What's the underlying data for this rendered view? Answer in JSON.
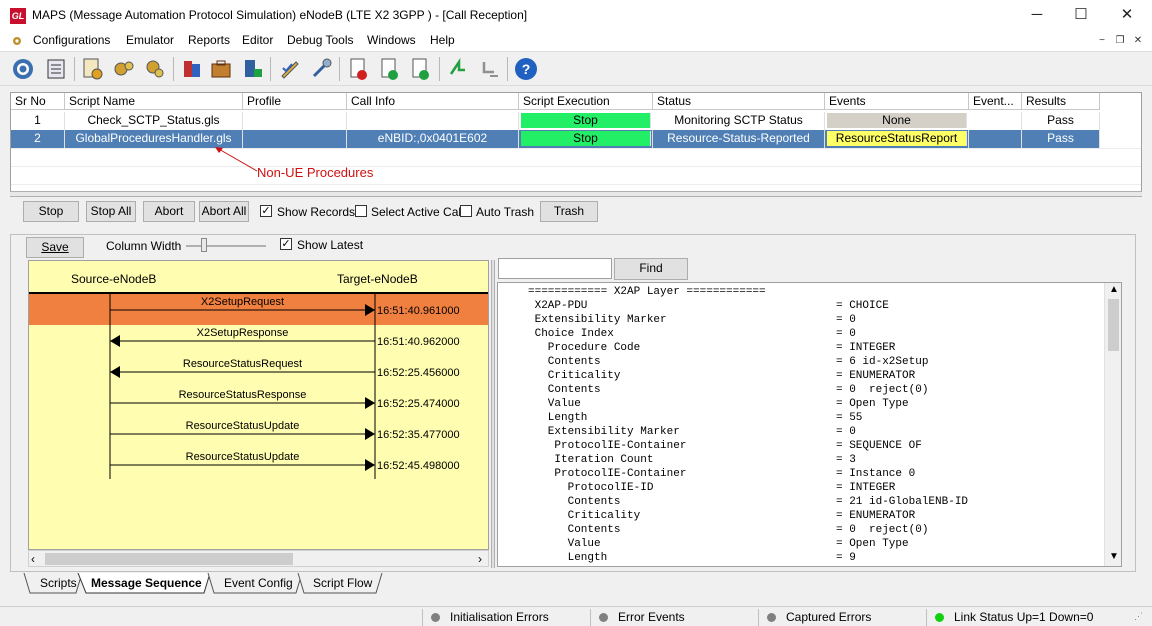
{
  "window": {
    "title": "MAPS (Message Automation Protocol Simulation) eNodeB (LTE X2 3GPP ) - [Call Reception]",
    "app_icon_text": "GL",
    "minimize": "─",
    "maximize": "☐",
    "close": "✕"
  },
  "menu": {
    "items": [
      "Configurations",
      "Emulator",
      "Reports",
      "Editor",
      "Debug Tools",
      "Windows",
      "Help"
    ]
  },
  "grid": {
    "columns": [
      "Sr No",
      "Script Name",
      "Profile",
      "Call Info",
      "Script Execution",
      "Status",
      "Events",
      "Event...",
      "Results"
    ],
    "rows": [
      {
        "sr": "1",
        "script": "Check_SCTP_Status.gls",
        "profile": "",
        "callinfo": "",
        "exec": "Stop",
        "status": "Monitoring SCTP Status",
        "events": "None",
        "event2": "",
        "results": "Pass"
      },
      {
        "sr": "2",
        "script": "GlobalProceduresHandler.gls",
        "profile": "",
        "callinfo": "eNBID:,0x0401E602",
        "exec": "Stop",
        "status": "Resource-Status-Reported",
        "events": "ResourceStatusReport",
        "event2": "",
        "results": "Pass"
      }
    ],
    "annotation": "Non-UE Procedures"
  },
  "controls": {
    "stop": "Stop",
    "stop_all": "Stop All",
    "abort": "Abort",
    "abort_all": "Abort All",
    "show_records": "Show Records",
    "select_active_call": "Select Active Call",
    "auto_trash": "Auto Trash",
    "trash": "Trash",
    "save": "Save",
    "column_width": "Column Width",
    "show_latest": "Show Latest",
    "find": "Find"
  },
  "sequence": {
    "source": "Source-eNodeB",
    "target": "Target-eNodeB",
    "messages": [
      {
        "label": "X2SetupRequest",
        "time": "16:51:40.961000",
        "dir": "right",
        "selected": true
      },
      {
        "label": "X2SetupResponse",
        "time": "16:51:40.962000",
        "dir": "left",
        "selected": false
      },
      {
        "label": "ResourceStatusRequest",
        "time": "16:52:25.456000",
        "dir": "left",
        "selected": false
      },
      {
        "label": "ResourceStatusResponse",
        "time": "16:52:25.474000",
        "dir": "right",
        "selected": false
      },
      {
        "label": "ResourceStatusUpdate",
        "time": "16:52:35.477000",
        "dir": "right",
        "selected": false
      },
      {
        "label": "ResourceStatusUpdate",
        "time": "16:52:45.498000",
        "dir": "right",
        "selected": false
      }
    ]
  },
  "decode": {
    "lines": [
      [
        "============ X2AP Layer ============",
        ""
      ],
      [
        " X2AP-PDU",
        "= CHOICE"
      ],
      [
        " Extensibility Marker",
        "= 0"
      ],
      [
        " Choice Index",
        "= 0"
      ],
      [
        "   Procedure Code",
        "= INTEGER"
      ],
      [
        "   Contents",
        "= 6 id-x2Setup"
      ],
      [
        "   Criticality",
        "= ENUMERATOR"
      ],
      [
        "   Contents",
        "= 0  reject(0)"
      ],
      [
        "   Value",
        "= Open Type"
      ],
      [
        "   Length",
        "= 55"
      ],
      [
        "   Extensibility Marker",
        "= 0"
      ],
      [
        "    ProtocolIE-Container",
        "= SEQUENCE OF"
      ],
      [
        "    Iteration Count",
        "= 3"
      ],
      [
        "    ProtocolIE-Container",
        "= Instance 0"
      ],
      [
        "      ProtocolIE-ID",
        "= INTEGER"
      ],
      [
        "      Contents",
        "= 21 id-GlobalENB-ID"
      ],
      [
        "      Criticality",
        "= ENUMERATOR"
      ],
      [
        "      Contents",
        "= 0  reject(0)"
      ],
      [
        "      Value",
        "= Open Type"
      ],
      [
        "      Length",
        "= 9"
      ]
    ]
  },
  "tabs": [
    "Scripts",
    "Message Sequence",
    "Event Config",
    "Script Flow"
  ],
  "active_tab": "Message Sequence",
  "status_bar": {
    "init_errors": "Initialisation Errors",
    "error_events": "Error Events",
    "captured_errors": "Captured Errors",
    "link_status": "Link Status Up=1 Down=0"
  },
  "colors": {
    "exec_green": "#22ee66",
    "selected_row": "#4f7fb4",
    "event_none": "#d4d0c8",
    "event_yellow": "#ffff66",
    "seq_bg": "#fffdb0",
    "seq_selected": "#f08040",
    "annotation_red": "#d01010",
    "link_green": "#10d010",
    "gray_dot": "#808080"
  }
}
